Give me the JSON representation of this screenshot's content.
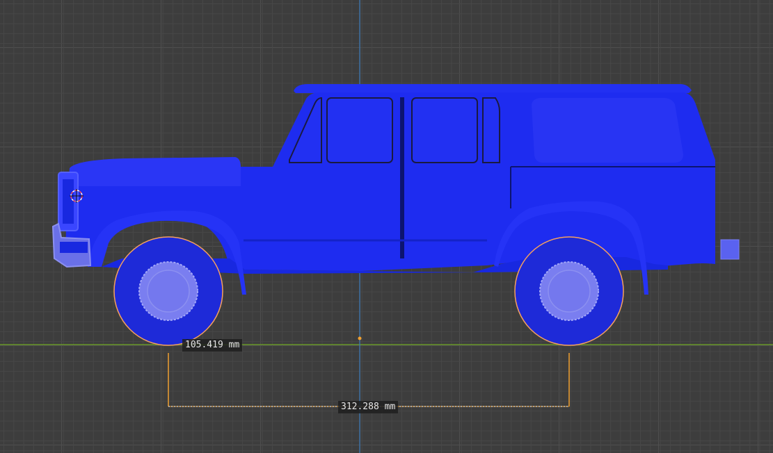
{
  "viewport": {
    "background": "#3d3d3d",
    "grid_color": "#474747",
    "x_axis_color": "#6a9a2a",
    "z_axis_color": "#3a78b8"
  },
  "model": {
    "body_color": "#1f2df0",
    "highlight_color": "#3a46ff",
    "wheel_rim_color": "#7a7ef0",
    "selection_outline": "#f5a060"
  },
  "measurements": {
    "wheel_height_label": "105.419 mm",
    "wheelbase_label": "312.288 mm",
    "ruler_color": "#f0a030"
  }
}
